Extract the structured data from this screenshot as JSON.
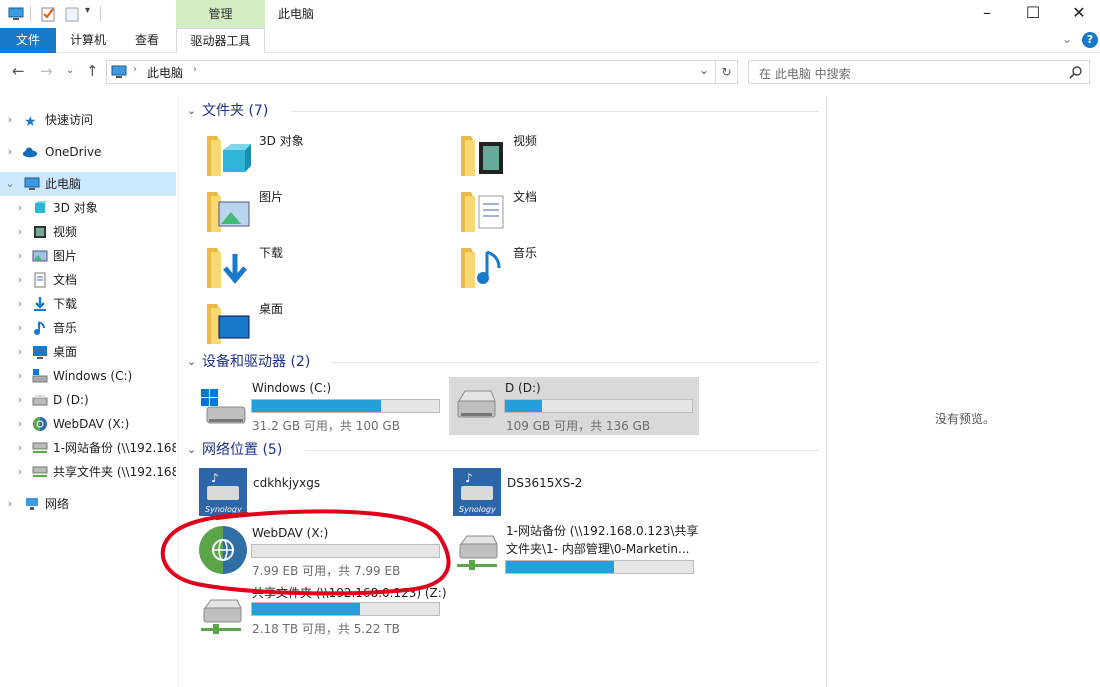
{
  "window": {
    "title": "此电脑",
    "context_tab_group": "管理"
  },
  "ribbon": {
    "tabs": [
      "文件",
      "计算机",
      "查看",
      "驱动器工具"
    ]
  },
  "address": {
    "path": "此电脑",
    "search_placeholder": "在 此电脑 中搜索"
  },
  "nav": {
    "quick_access": "快速访问",
    "onedrive": "OneDrive",
    "this_pc": "此电脑",
    "children": [
      "3D 对象",
      "视频",
      "图片",
      "文档",
      "下载",
      "音乐",
      "桌面",
      "Windows (C:)",
      "D (D:)",
      "WebDAV (X:)",
      "1-网站备份 (\\\\192.168",
      "共享文件夹 (\\\\192.168"
    ],
    "network": "网络"
  },
  "groups": {
    "folders": "文件夹 (7)",
    "devices": "设备和驱动器 (2)",
    "network": "网络位置 (5)"
  },
  "folders": [
    "3D 对象",
    "视频",
    "图片",
    "文档",
    "下载",
    "音乐",
    "桌面"
  ],
  "drives": [
    {
      "name": "Windows (C:)",
      "info": "31.2 GB 可用，共 100 GB",
      "used": 0.69
    },
    {
      "name": "D (D:)",
      "info": "109 GB 可用，共 136 GB",
      "used": 0.2
    }
  ],
  "netlocs": [
    {
      "name": "cdkhkjyxgs"
    },
    {
      "name": "DS3615XS-2"
    },
    {
      "name": "WebDAV (X:)",
      "info": "7.99 EB 可用，共 7.99 EB",
      "used": 0.0
    },
    {
      "name": "1-网站备份 (\\\\192.168.0.123\\共享",
      "name2": "文件夹\\1- 内部管理\\0-Marketin...",
      "used": 0.58
    },
    {
      "name": "共享文件夹 (\\\\192.168.0.123) (Z:)",
      "info": "2.18 TB 可用，共 5.22 TB",
      "used": 0.58
    }
  ],
  "nas_brand": "Synology",
  "preview": {
    "empty_text": "没有预览。"
  },
  "colors": {
    "accent": "#1979ca",
    "bar": "#26a0da",
    "folder": "#f8d775",
    "annotation": "#e0001b"
  }
}
